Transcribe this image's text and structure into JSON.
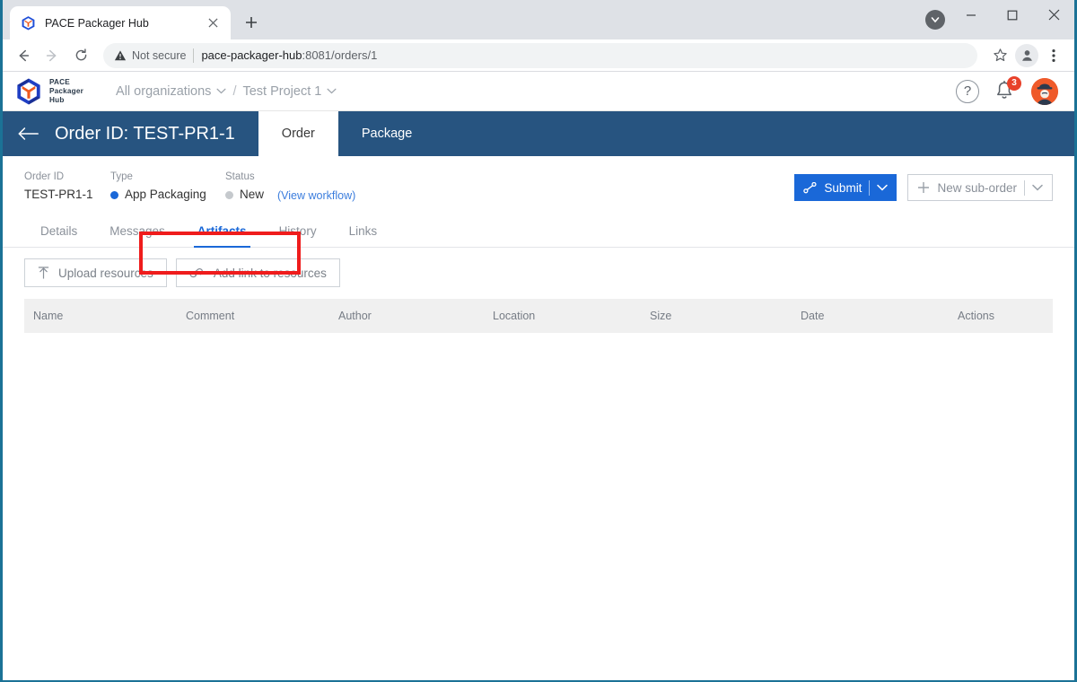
{
  "browser": {
    "tab": {
      "title": "PACE Packager Hub",
      "favicon": "pace-cube-favicon",
      "close_label": "×"
    },
    "new_tab_label": "+",
    "window_controls": {
      "minimize": "—",
      "maximize": "□",
      "close": "✕",
      "update": "chevron-down-icon"
    },
    "nav": {
      "back": "back-arrow-icon",
      "forward": "forward-arrow-icon",
      "reload": "reload-icon"
    },
    "omnibox": {
      "security_label": "Not secure",
      "url_host": "pace-packager-hub",
      "url_rest": ":8081/orders/1",
      "url_full": "pace-packager-hub:8081/orders/1",
      "bookmark": "star-icon",
      "profile": "profile-icon",
      "menu": "three-dot-menu-icon"
    }
  },
  "app": {
    "brand": {
      "line1": "PACE",
      "line2": "Packager",
      "line3": "Hub"
    },
    "breadcrumb": {
      "organizations": "All organizations",
      "separator": "/",
      "project": "Test Project 1"
    },
    "header_actions": {
      "help": "?",
      "notifications_count": "3",
      "avatar": "user-avatar"
    },
    "order_bar": {
      "back": "back-arrow-icon",
      "title": "Order ID: TEST-PR1-1",
      "tabs": [
        {
          "label": "Order",
          "active": true
        },
        {
          "label": "Package",
          "active": false
        }
      ]
    },
    "meta": {
      "fields": [
        {
          "label": "Order ID",
          "value": "TEST-PR1-1",
          "dot": null
        },
        {
          "label": "Type",
          "value": "App Packaging",
          "dot": "#1a68d8"
        },
        {
          "label": "Status",
          "value": "New",
          "dot": "#c5c9cd"
        }
      ],
      "workflow_link": "(View workflow)"
    },
    "actions": {
      "submit": {
        "label": "Submit",
        "icon": "workflow-branch-icon",
        "chevron": "chevron-down-icon"
      },
      "new_sub_order": {
        "label": "New sub-order",
        "icon": "plus-icon",
        "chevron": "chevron-down-icon"
      }
    },
    "nav_tabs": [
      {
        "label": "Details",
        "active": false
      },
      {
        "label": "Messages",
        "active": false
      },
      {
        "label": "Artifacts",
        "active": true
      },
      {
        "label": "History",
        "active": false
      },
      {
        "label": "Links",
        "active": false
      }
    ],
    "artifacts": {
      "toolbar": [
        {
          "label": "Upload resources",
          "icon": "upload-icon"
        },
        {
          "label": "Add link to resources",
          "icon": "link-icon"
        }
      ],
      "columns": [
        "Name",
        "Comment",
        "Author",
        "Location",
        "Size",
        "Date",
        "Actions"
      ],
      "rows": []
    }
  },
  "annotation": {
    "type": "highlight-rectangle",
    "color": "#ef1c1c",
    "target": "Add link to resources"
  }
}
